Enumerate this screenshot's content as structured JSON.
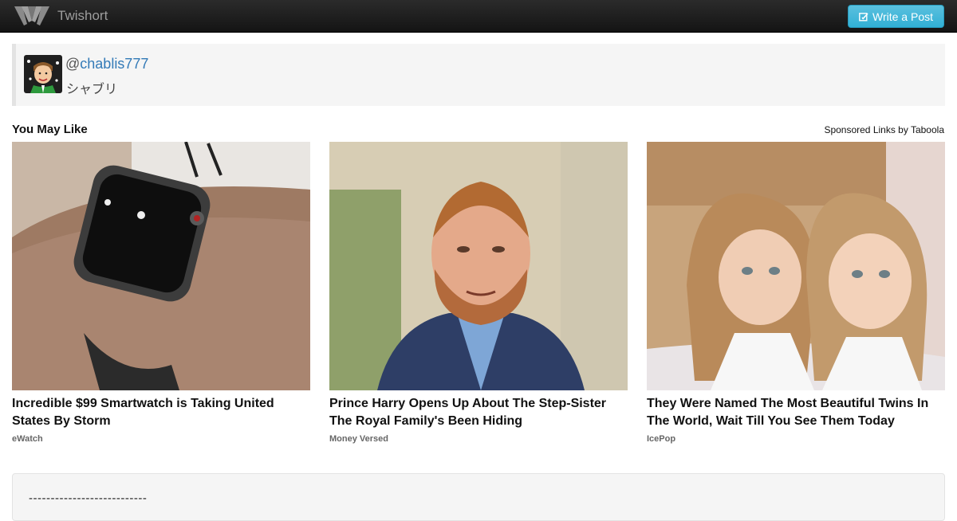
{
  "navbar": {
    "brand_name": "Twishort",
    "write_button_label": "Write a Post",
    "icons": {
      "logo": "twishort-logo-icon",
      "write": "edit-icon"
    },
    "accent_color": "#5bc0de"
  },
  "profile": {
    "at": "@",
    "username": "chablis777",
    "display_name": "シャブリ"
  },
  "recommendations": {
    "heading": "You May Like",
    "sponsored_label": "Sponsored Links by Taboola",
    "cards": [
      {
        "headline": "Incredible $99 Smartwatch is Taking United States By Storm",
        "source": "eWatch"
      },
      {
        "headline": "Prince Harry Opens Up About The Step-Sister The Royal Family's Been Hiding",
        "source": "Money Versed"
      },
      {
        "headline": "They Were Named The Most Beautiful Twins In The World, Wait Till You See Them Today",
        "source": "IcePop"
      }
    ]
  },
  "post": {
    "text": "---------------------------"
  }
}
